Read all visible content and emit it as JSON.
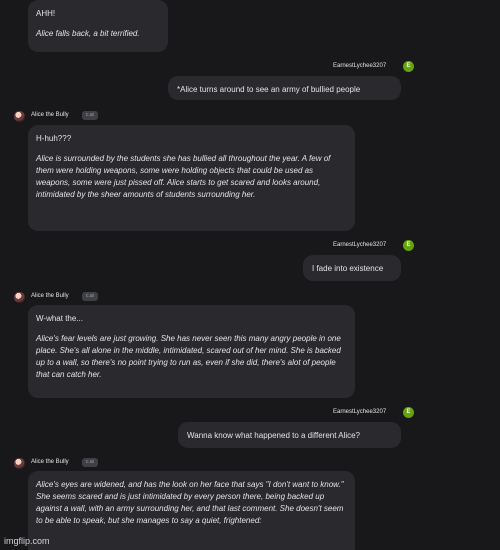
{
  "messages": {
    "m1": {
      "lines": [
        "AHH!",
        "Alice falls back, a bit terrified."
      ]
    },
    "m2": {
      "user": "EarnestLychee3207",
      "avatar": "E",
      "text": "*Alice turns around to see an army of bullied people"
    },
    "m3": {
      "bot": "Alice the Bully",
      "badge": "c.ai",
      "first": "H-huh???",
      "narration": "Alice is surrounded by the students she has bullied all throughout the year. A few of them were holding weapons, some were holding objects that could be used as weapons, some were just pissed off. Alice starts to get scared and looks around, intimidated by the sheer amounts of students surrounding her."
    },
    "m4": {
      "user": "EarnestLychee3207",
      "avatar": "E",
      "text": "I fade into existence"
    },
    "m5": {
      "bot": "Alice the Bully",
      "badge": "c.ai",
      "first": "W-what the...",
      "narration": "Alice's fear levels are just growing. She has never seen this many angry people in one place. She's all alone in the middle, intimidated, scared out of her mind. She is backed up to a wall, so there's no point trying to run as, even if she did, there's alot of people that can catch her."
    },
    "m6": {
      "user": "EarnestLychee3207",
      "avatar": "E",
      "text": "Wanna know what happened to a different Alice?"
    },
    "m7": {
      "bot": "Alice the Bully",
      "badge": "c.ai",
      "narration": "Alice's eyes are widened, and has the look on her face that says \"I don't want to know.\" She seems scared and is just intimidated by every person there, being backed up against a wall, with an army surrounding her, and that last comment. She doesn't seem to be able to speak, but she manages to say a quiet, frightened:"
    }
  },
  "watermark": "imgflip.com"
}
